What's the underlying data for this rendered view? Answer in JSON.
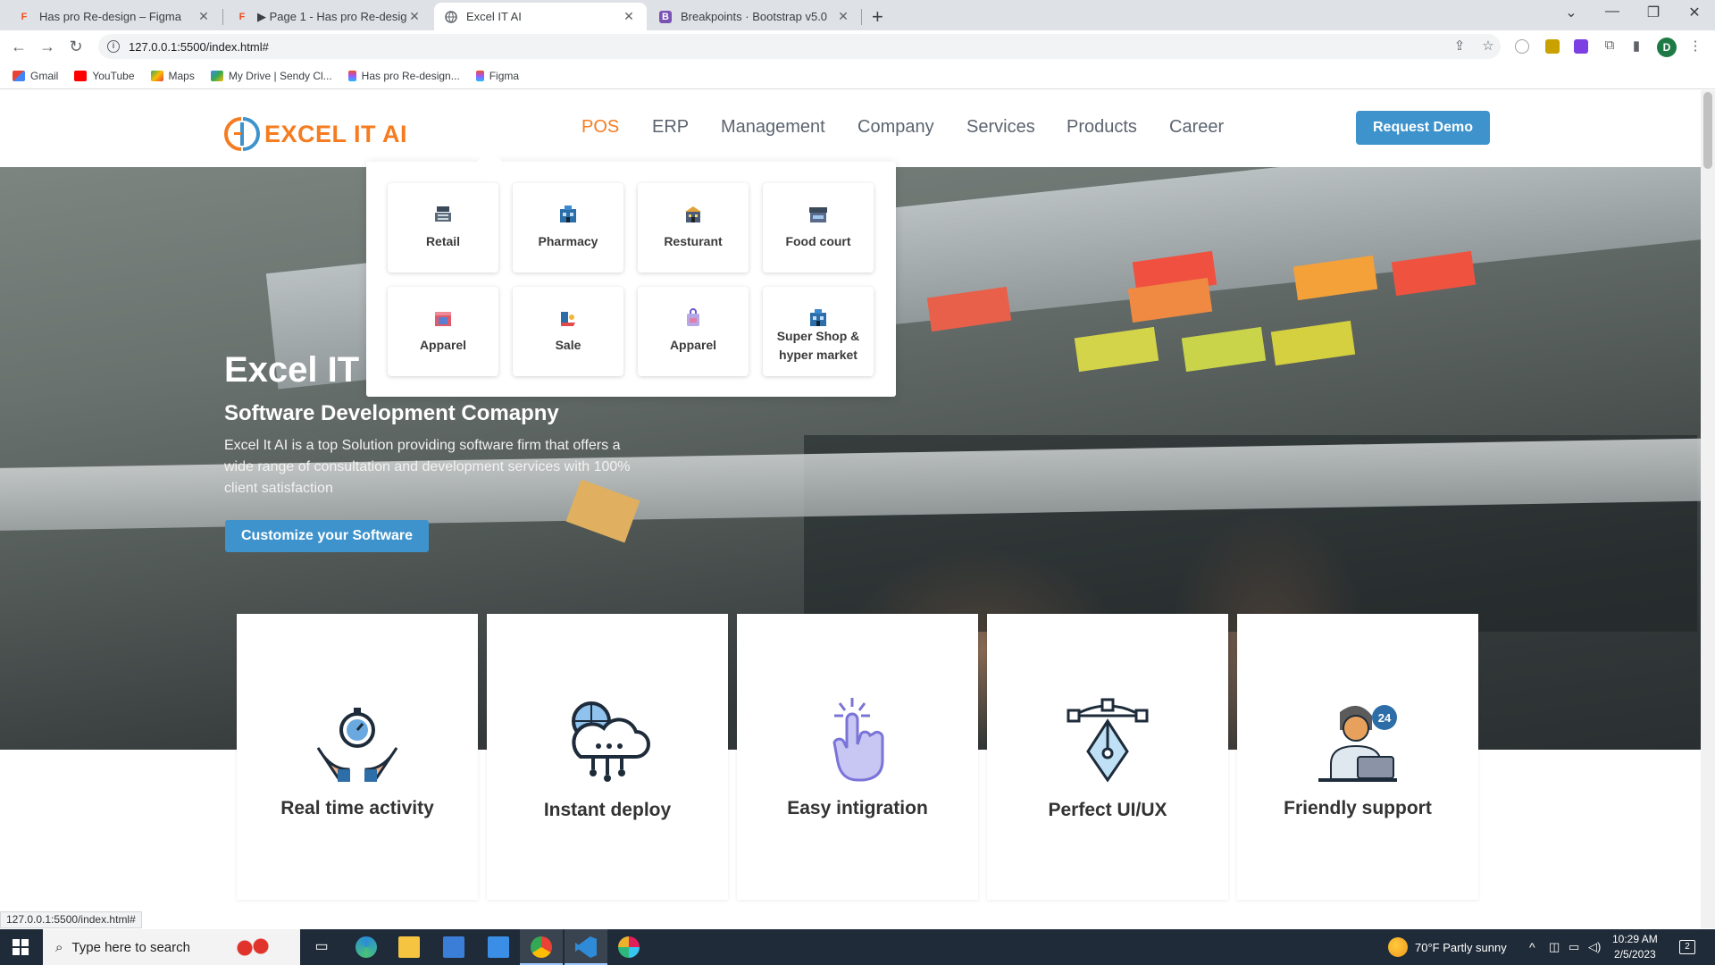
{
  "browser": {
    "tabs": [
      {
        "title": "Has pro Re-design – Figma",
        "icon": "figma-icon",
        "active": false
      },
      {
        "title": "▶ Page 1 - Has pro Re-design",
        "icon": "figma-icon",
        "active": false
      },
      {
        "title": "Excel IT AI",
        "icon": "globe-icon",
        "active": true
      },
      {
        "title": "Breakpoints · Bootstrap v5.0",
        "icon": "bootstrap-icon",
        "active": false
      }
    ],
    "tab_close": "✕",
    "new_tab": "+",
    "url": "127.0.0.1:5500/index.html#",
    "profile_initial": "D",
    "bookmarks": [
      {
        "label": "Gmail",
        "icon": "gmail-icon"
      },
      {
        "label": "YouTube",
        "icon": "youtube-icon"
      },
      {
        "label": "Maps",
        "icon": "maps-icon"
      },
      {
        "label": "My Drive | Sendy Cl...",
        "icon": "drive-icon"
      },
      {
        "label": "Has pro Re-design...",
        "icon": "figma-icon"
      },
      {
        "label": "Figma",
        "icon": "figma-icon"
      }
    ],
    "status_url": "127.0.0.1:5500/index.html#"
  },
  "site": {
    "logo_text": "EXCEL IT AI",
    "nav": [
      {
        "label": "POS",
        "active": true
      },
      {
        "label": "ERP",
        "active": false
      },
      {
        "label": "Management",
        "active": false
      },
      {
        "label": "Company",
        "active": false
      },
      {
        "label": "Services",
        "active": false
      },
      {
        "label": "Products",
        "active": false
      },
      {
        "label": "Career",
        "active": false
      }
    ],
    "request_demo": "Request Demo",
    "dropdown": [
      {
        "label": "Retail",
        "icon": "cash-register-icon"
      },
      {
        "label": "Pharmacy",
        "icon": "pharmacy-building-icon"
      },
      {
        "label": "Resturant",
        "icon": "restaurant-icon"
      },
      {
        "label": "Food court",
        "icon": "food-stall-icon"
      },
      {
        "label": "Apparel",
        "icon": "apparel-store-icon"
      },
      {
        "label": "Sale",
        "icon": "sale-icon"
      },
      {
        "label": "Apparel",
        "icon": "shopping-bag-icon"
      },
      {
        "label": "Super Shop & hyper market",
        "icon": "supermarket-icon"
      }
    ],
    "hero": {
      "title": "Excel IT",
      "subtitle": "Software Development Comapny",
      "description": "Excel It AI is a top Solution providing software firm that offers a wide range of consultation and development services with 100% client satisfaction",
      "cta": "Customize your Software"
    },
    "features": [
      {
        "label": "Real time activity",
        "icon": "stopwatch-hands-icon"
      },
      {
        "label": "Instant deploy",
        "icon": "cloud-network-icon"
      },
      {
        "label": "Easy intigration",
        "icon": "touch-hand-icon"
      },
      {
        "label": "Perfect UI/UX",
        "icon": "vector-pen-icon"
      },
      {
        "label": "Friendly support",
        "icon": "support-agent-icon"
      }
    ],
    "colors": {
      "accent": "#f57c20",
      "primary": "#3e93cc"
    }
  },
  "taskbar": {
    "search_placeholder": "Type here to search",
    "weather": "70°F  Partly sunny",
    "time": "10:29 AM",
    "date": "2/5/2023",
    "notifications": "2"
  }
}
